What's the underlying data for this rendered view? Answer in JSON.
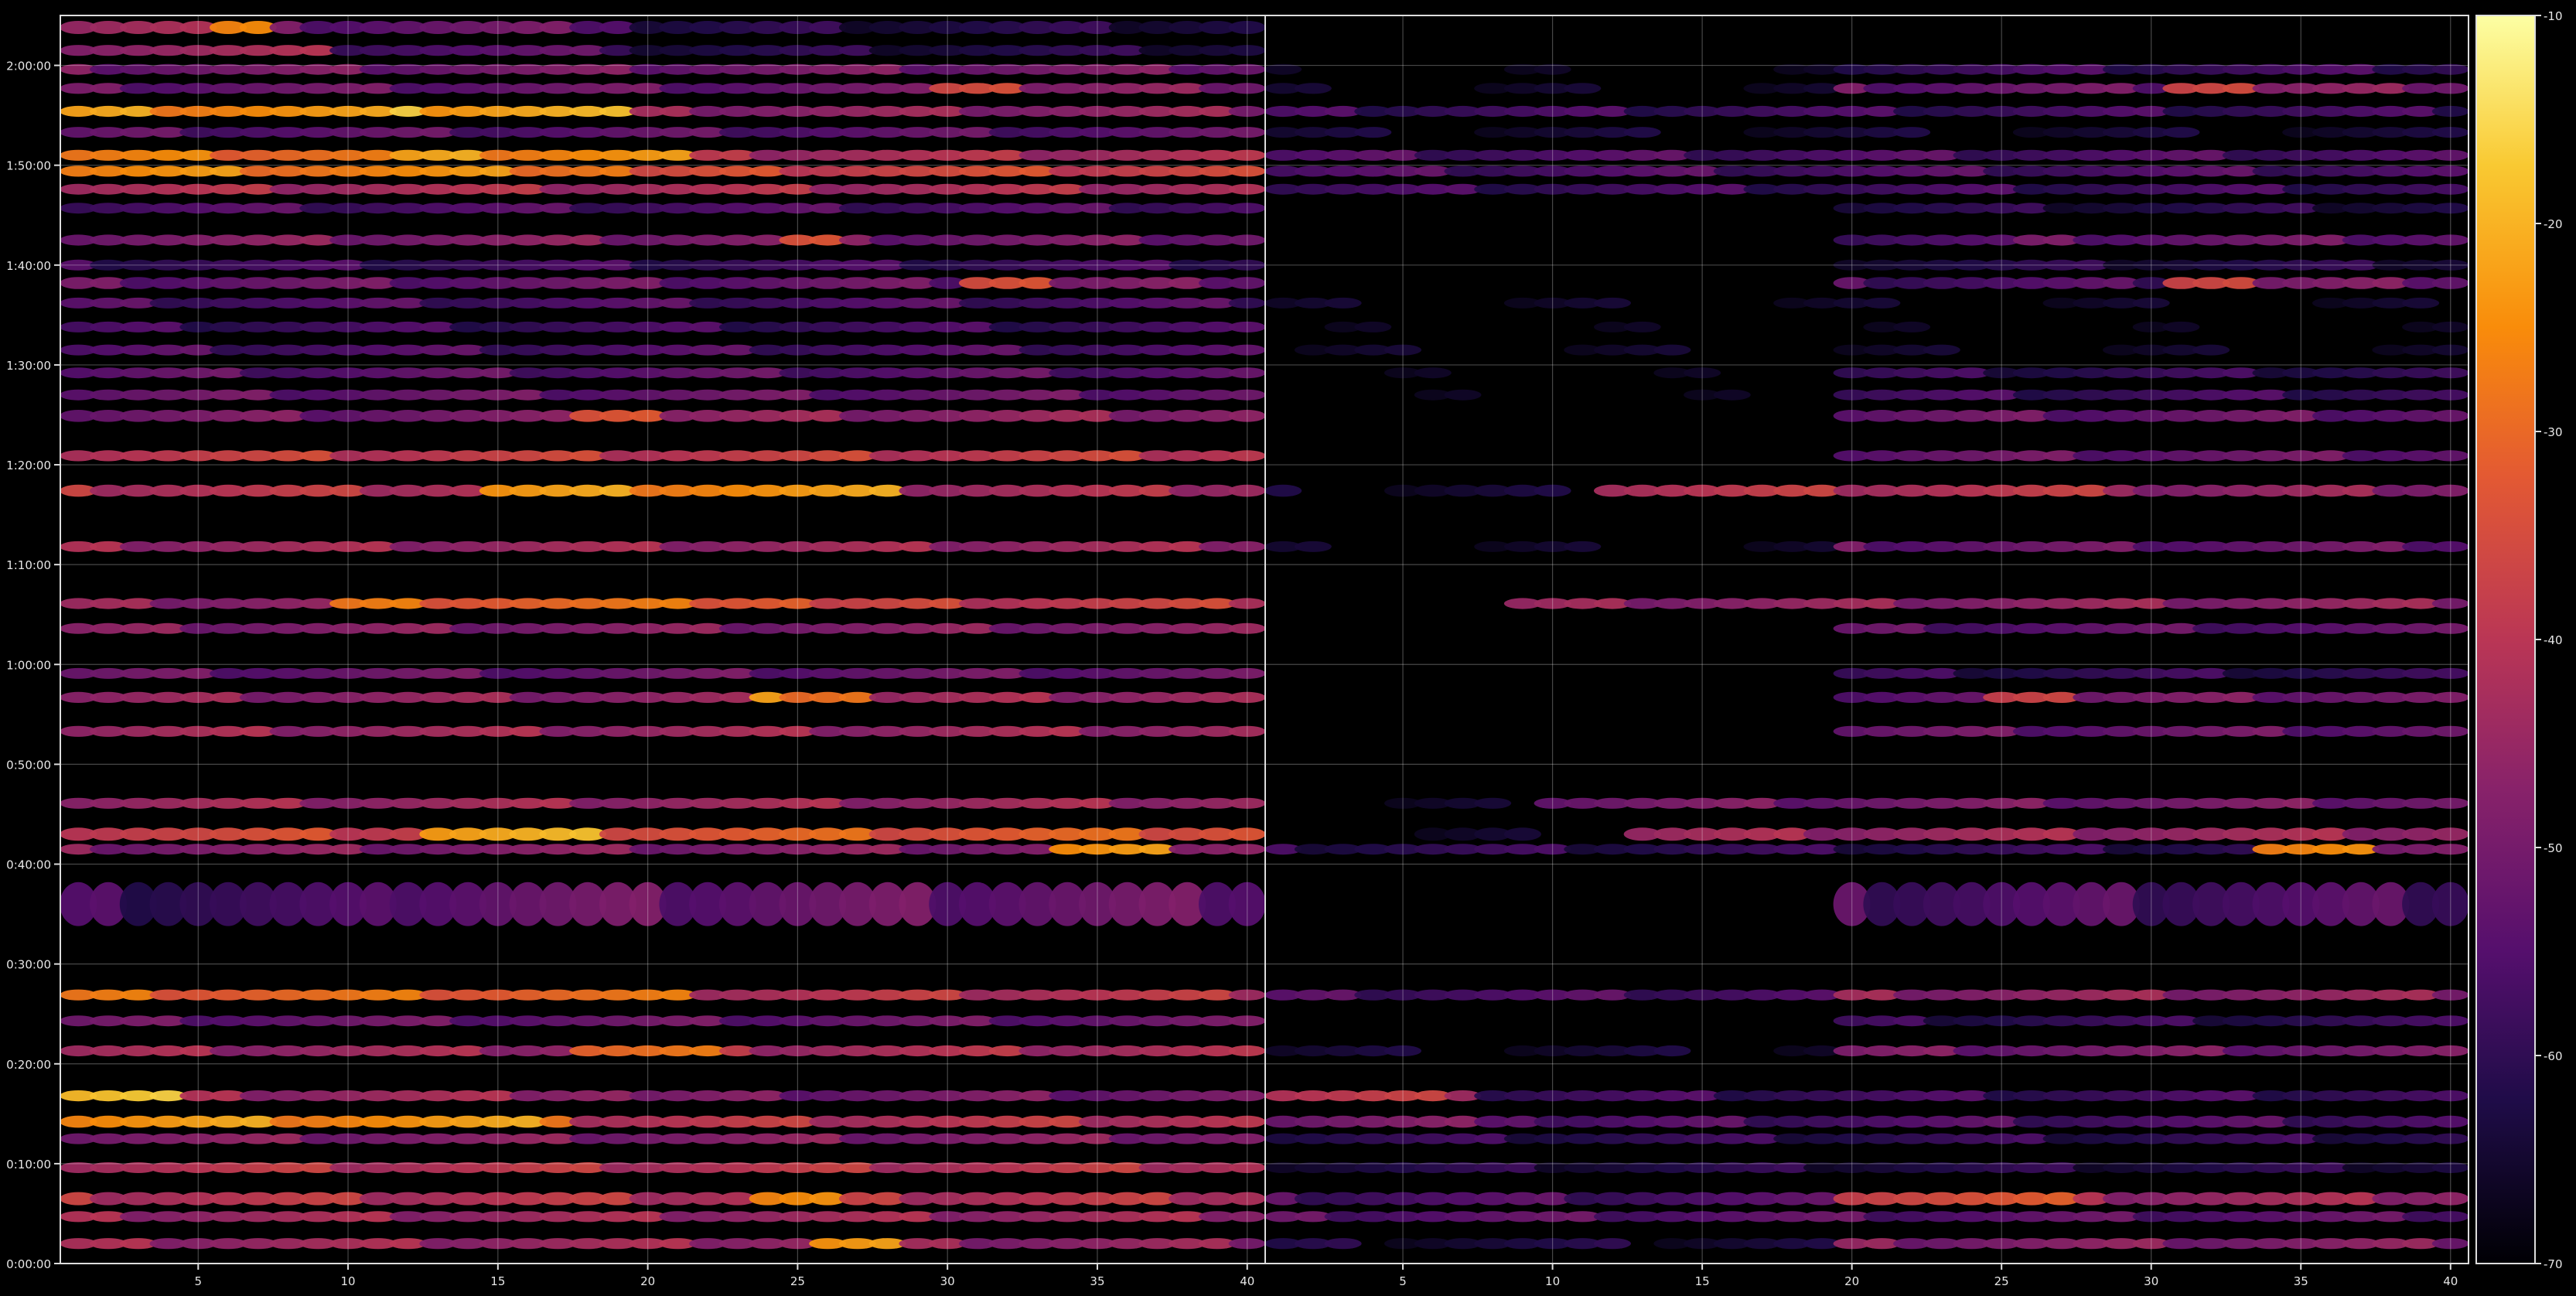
{
  "chart_data": {
    "type": "heatmap",
    "colormap": "inferno",
    "background": "#000000",
    "grid": true,
    "panels": [
      {
        "name": "",
        "x_range": [
          1,
          40
        ],
        "x_ticks": [
          "5",
          "10",
          "15",
          "20",
          "25",
          "30",
          "35",
          "40"
        ],
        "x_tick_values": [
          5,
          10,
          15,
          20,
          25,
          30,
          35,
          40
        ]
      },
      {
        "name": "",
        "x_range": [
          1,
          40
        ],
        "x_ticks": [
          "5",
          "10",
          "15",
          "20",
          "25",
          "30",
          "35",
          "40"
        ],
        "x_tick_values": [
          5,
          10,
          15,
          20,
          25,
          30,
          35,
          40
        ]
      }
    ],
    "y_axis": {
      "unit": "minutes",
      "range": [
        0,
        125
      ],
      "ticks": [
        "0:00:00",
        "0:10:00",
        "0:20:00",
        "0:30:00",
        "0:40:00",
        "0:50:00",
        "1:00:00",
        "1:10:00",
        "1:20:00",
        "1:30:00",
        "1:40:00",
        "1:50:00",
        "2:00:00"
      ],
      "tick_values": [
        0,
        10,
        20,
        30,
        40,
        50,
        60,
        70,
        80,
        90,
        100,
        110,
        120
      ]
    },
    "colorbar": {
      "range": [
        -70,
        -10
      ],
      "ticks": [
        "-10",
        "-20",
        "-30",
        "-40",
        "-50",
        "-60",
        "-70"
      ],
      "tick_values": [
        -10,
        -20,
        -30,
        -40,
        -50,
        -60,
        -70
      ]
    },
    "bands": [
      {
        "t": 123.8,
        "h": 1.2,
        "a": [
          [
            1,
            6,
            -42
          ],
          [
            6,
            8,
            -28
          ],
          [
            8,
            20,
            -52
          ],
          [
            20,
            40,
            -62
          ]
        ],
        "b": [
          [
            1,
            40,
            -72
          ]
        ]
      },
      {
        "t": 121.5,
        "h": 1.0,
        "a": [
          [
            1,
            10,
            -44
          ],
          [
            10,
            20,
            -55
          ],
          [
            20,
            40,
            -62
          ]
        ],
        "b": [
          [
            1,
            40,
            -74
          ]
        ]
      },
      {
        "t": 119.6,
        "h": 0.9,
        "a": [
          [
            1,
            40,
            -50
          ]
        ],
        "b": [
          [
            1,
            20,
            -70
          ],
          [
            20,
            40,
            -58
          ]
        ]
      },
      {
        "t": 117.7,
        "h": 1.0,
        "a": [
          [
            1,
            30,
            -52
          ],
          [
            30,
            33,
            -32
          ],
          [
            33,
            40,
            -48
          ]
        ],
        "b": [
          [
            1,
            20,
            -68
          ],
          [
            20,
            31,
            -52
          ],
          [
            31,
            34,
            -34
          ],
          [
            34,
            40,
            -48
          ]
        ]
      },
      {
        "t": 115.4,
        "h": 1.0,
        "a": [
          [
            1,
            12,
            -24
          ],
          [
            12,
            20,
            -20
          ],
          [
            20,
            40,
            -46
          ]
        ],
        "b": [
          [
            1,
            40,
            -58
          ]
        ]
      },
      {
        "t": 113.3,
        "h": 0.8,
        "a": [
          [
            1,
            40,
            -54
          ]
        ],
        "b": [
          [
            1,
            40,
            -66
          ]
        ]
      },
      {
        "t": 111.0,
        "h": 1.0,
        "a": [
          [
            1,
            12,
            -28
          ],
          [
            12,
            22,
            -24
          ],
          [
            22,
            40,
            -42
          ]
        ],
        "b": [
          [
            1,
            40,
            -56
          ]
        ]
      },
      {
        "t": 109.4,
        "h": 1.0,
        "a": [
          [
            1,
            20,
            -26
          ],
          [
            20,
            40,
            -36
          ]
        ],
        "b": [
          [
            1,
            40,
            -56
          ]
        ]
      },
      {
        "t": 107.6,
        "h": 0.9,
        "a": [
          [
            1,
            40,
            -42
          ]
        ],
        "b": [
          [
            1,
            40,
            -58
          ]
        ]
      },
      {
        "t": 105.7,
        "h": 0.8,
        "a": [
          [
            1,
            40,
            -56
          ]
        ],
        "b": [
          [
            1,
            20,
            -74
          ],
          [
            20,
            40,
            -62
          ]
        ]
      },
      {
        "t": 102.5,
        "h": 1.0,
        "a": [
          [
            1,
            25,
            -48
          ],
          [
            25,
            27,
            -36
          ],
          [
            27,
            40,
            -50
          ]
        ],
        "b": [
          [
            1,
            20,
            -72
          ],
          [
            20,
            26,
            -56
          ],
          [
            26,
            40,
            -52
          ]
        ]
      },
      {
        "t": 100.0,
        "h": 0.9,
        "a": [
          [
            1,
            40,
            -58
          ]
        ],
        "b": [
          [
            1,
            20,
            -76
          ],
          [
            20,
            40,
            -62
          ]
        ]
      },
      {
        "t": 98.2,
        "h": 1.1,
        "a": [
          [
            1,
            31,
            -52
          ],
          [
            31,
            34,
            -32
          ],
          [
            34,
            40,
            -50
          ]
        ],
        "b": [
          [
            1,
            20,
            -74
          ],
          [
            20,
            31,
            -56
          ],
          [
            31,
            34,
            -34
          ],
          [
            34,
            40,
            -50
          ]
        ]
      },
      {
        "t": 96.2,
        "h": 0.9,
        "a": [
          [
            1,
            40,
            -56
          ]
        ],
        "b": [
          [
            1,
            40,
            -68
          ]
        ]
      },
      {
        "t": 93.8,
        "h": 0.9,
        "a": [
          [
            1,
            40,
            -58
          ]
        ],
        "b": [
          [
            1,
            40,
            -70
          ]
        ]
      },
      {
        "t": 91.5,
        "h": 0.9,
        "a": [
          [
            1,
            40,
            -56
          ]
        ],
        "b": [
          [
            1,
            40,
            -68
          ]
        ]
      },
      {
        "t": 89.2,
        "h": 0.9,
        "a": [
          [
            1,
            40,
            -54
          ]
        ],
        "b": [
          [
            1,
            20,
            -70
          ],
          [
            20,
            40,
            -60
          ]
        ]
      },
      {
        "t": 87.0,
        "h": 0.9,
        "a": [
          [
            1,
            40,
            -52
          ]
        ],
        "b": [
          [
            1,
            20,
            -70
          ],
          [
            20,
            40,
            -58
          ]
        ]
      },
      {
        "t": 84.9,
        "h": 1.1,
        "a": [
          [
            1,
            18,
            -50
          ],
          [
            18,
            21,
            -30
          ],
          [
            21,
            40,
            -46
          ]
        ],
        "b": [
          [
            1,
            20,
            -72
          ],
          [
            20,
            40,
            -52
          ]
        ]
      },
      {
        "t": 80.9,
        "h": 1.0,
        "a": [
          [
            1,
            40,
            -38
          ]
        ],
        "b": [
          [
            1,
            20,
            -72
          ],
          [
            20,
            40,
            -52
          ]
        ]
      },
      {
        "t": 77.4,
        "h": 1.1,
        "a": [
          [
            1,
            15,
            -40
          ],
          [
            15,
            29,
            -24
          ],
          [
            29,
            40,
            -42
          ]
        ],
        "b": [
          [
            1,
            12,
            -66
          ],
          [
            12,
            30,
            -40
          ],
          [
            30,
            40,
            -46
          ]
        ]
      },
      {
        "t": 71.8,
        "h": 0.9,
        "a": [
          [
            1,
            40,
            -44
          ]
        ],
        "b": [
          [
            1,
            20,
            -68
          ],
          [
            20,
            40,
            -52
          ]
        ]
      },
      {
        "t": 66.1,
        "h": 1.0,
        "a": [
          [
            1,
            10,
            -46
          ],
          [
            10,
            26,
            -30
          ],
          [
            26,
            40,
            -38
          ]
        ],
        "b": [
          [
            1,
            9,
            -76
          ],
          [
            9,
            40,
            -46
          ]
        ]
      },
      {
        "t": 63.6,
        "h": 0.9,
        "a": [
          [
            1,
            40,
            -48
          ]
        ],
        "b": [
          [
            1,
            20,
            -74
          ],
          [
            20,
            40,
            -54
          ]
        ]
      },
      {
        "t": 59.1,
        "h": 0.9,
        "a": [
          [
            1,
            40,
            -52
          ]
        ],
        "b": [
          [
            1,
            20,
            -76
          ],
          [
            20,
            40,
            -60
          ]
        ]
      },
      {
        "t": 56.7,
        "h": 1.0,
        "a": [
          [
            1,
            24,
            -46
          ],
          [
            24,
            28,
            -26
          ],
          [
            28,
            40,
            -44
          ]
        ],
        "b": [
          [
            1,
            20,
            -72
          ],
          [
            20,
            25,
            -56
          ],
          [
            25,
            28,
            -34
          ],
          [
            28,
            40,
            -50
          ]
        ]
      },
      {
        "t": 53.3,
        "h": 1.0,
        "a": [
          [
            1,
            40,
            -44
          ]
        ],
        "b": [
          [
            1,
            20,
            -74
          ],
          [
            20,
            40,
            -52
          ]
        ]
      },
      {
        "t": 46.1,
        "h": 1.0,
        "a": [
          [
            1,
            40,
            -44
          ]
        ],
        "b": [
          [
            1,
            10,
            -68
          ],
          [
            10,
            40,
            -50
          ]
        ]
      },
      {
        "t": 43.0,
        "h": 1.2,
        "a": [
          [
            1,
            13,
            -36
          ],
          [
            13,
            19,
            -22
          ],
          [
            19,
            40,
            -32
          ]
        ],
        "b": [
          [
            1,
            13,
            -68
          ],
          [
            13,
            40,
            -44
          ]
        ]
      },
      {
        "t": 41.5,
        "h": 0.9,
        "a": [
          [
            1,
            34,
            -48
          ],
          [
            34,
            38,
            -26
          ],
          [
            38,
            40,
            -44
          ]
        ],
        "b": [
          [
            1,
            34,
            -60
          ],
          [
            34,
            38,
            -28
          ],
          [
            38,
            40,
            -46
          ]
        ]
      },
      {
        "t": 36.0,
        "h": 4.0,
        "a": [
          [
            1,
            12,
            -58
          ],
          [
            12,
            40,
            -52
          ]
        ],
        "b": [
          [
            1,
            20,
            -76
          ],
          [
            20,
            40,
            -56
          ]
        ]
      },
      {
        "t": 26.9,
        "h": 1.0,
        "a": [
          [
            1,
            22,
            -30
          ],
          [
            22,
            40,
            -40
          ]
        ],
        "b": [
          [
            1,
            20,
            -56
          ],
          [
            20,
            40,
            -46
          ]
        ]
      },
      {
        "t": 24.3,
        "h": 0.9,
        "a": [
          [
            1,
            40,
            -52
          ]
        ],
        "b": [
          [
            1,
            20,
            -72
          ],
          [
            20,
            40,
            -60
          ]
        ]
      },
      {
        "t": 21.3,
        "h": 1.0,
        "a": [
          [
            1,
            18,
            -44
          ],
          [
            18,
            23,
            -30
          ],
          [
            23,
            40,
            -42
          ]
        ],
        "b": [
          [
            1,
            20,
            -66
          ],
          [
            20,
            40,
            -50
          ]
        ]
      },
      {
        "t": 16.8,
        "h": 1.0,
        "a": [
          [
            1,
            5,
            -18
          ],
          [
            5,
            20,
            -44
          ],
          [
            20,
            40,
            -50
          ]
        ],
        "b": [
          [
            1,
            8,
            -40
          ],
          [
            8,
            40,
            -58
          ]
        ]
      },
      {
        "t": 14.2,
        "h": 1.1,
        "a": [
          [
            1,
            18,
            -24
          ],
          [
            18,
            40,
            -40
          ]
        ],
        "b": [
          [
            1,
            10,
            -50
          ],
          [
            10,
            40,
            -56
          ]
        ]
      },
      {
        "t": 12.5,
        "h": 0.9,
        "a": [
          [
            1,
            40,
            -48
          ]
        ],
        "b": [
          [
            1,
            40,
            -60
          ]
        ]
      },
      {
        "t": 9.6,
        "h": 0.9,
        "a": [
          [
            1,
            40,
            -40
          ]
        ],
        "b": [
          [
            1,
            40,
            -62
          ]
        ]
      },
      {
        "t": 6.5,
        "h": 1.2,
        "a": [
          [
            1,
            24,
            -40
          ],
          [
            24,
            27,
            -26
          ],
          [
            27,
            40,
            -40
          ]
        ],
        "b": [
          [
            1,
            20,
            -56
          ],
          [
            20,
            28,
            -34
          ],
          [
            28,
            40,
            -44
          ]
        ]
      },
      {
        "t": 4.7,
        "h": 1.0,
        "a": [
          [
            1,
            40,
            -44
          ]
        ],
        "b": [
          [
            1,
            40,
            -54
          ]
        ]
      },
      {
        "t": 2.0,
        "h": 1.0,
        "a": [
          [
            1,
            26,
            -44
          ],
          [
            26,
            29,
            -24
          ],
          [
            29,
            40,
            -46
          ]
        ],
        "b": [
          [
            1,
            20,
            -64
          ],
          [
            20,
            40,
            -48
          ]
        ]
      }
    ]
  }
}
